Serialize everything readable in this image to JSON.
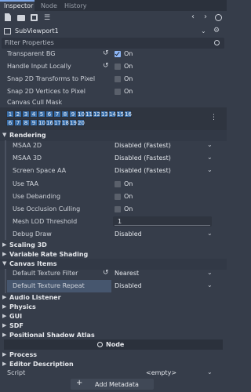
{
  "tabs": [
    "Inspector",
    "Node",
    "History"
  ],
  "node_name": "SubViewport1",
  "filter_placeholder": "Filter Properties",
  "props_top": [
    {
      "label": "Transparent BG",
      "value": "On",
      "checked": true,
      "revert": true
    },
    {
      "label": "Handle Input Locally",
      "value": "On",
      "checked": false,
      "revert": true
    },
    {
      "label": "Snap 2D Transforms to Pixel",
      "value": "On",
      "checked": false,
      "revert": false
    },
    {
      "label": "Snap 2D Vertices to Pixel",
      "value": "On",
      "checked": false,
      "revert": false
    }
  ],
  "cull_mask_label": "Canvas Cull Mask",
  "cull_mask_row1": [
    "1",
    "2",
    "3",
    "4",
    "5",
    "6",
    "7",
    "8",
    "9",
    "10",
    "11",
    "12",
    "13",
    "14",
    "15",
    "16"
  ],
  "cull_mask_row2": [
    "6",
    "7",
    "8",
    "9",
    "10",
    "16",
    "17",
    "18",
    "19",
    "20"
  ],
  "rendering": {
    "title": "Rendering",
    "msaa2d": {
      "label": "MSAA 2D",
      "value": "Disabled (Fastest)"
    },
    "msaa3d": {
      "label": "MSAA 3D",
      "value": "Disabled (Fastest)"
    },
    "ssaa": {
      "label": "Screen Space AA",
      "value": "Disabled (Fastest)"
    },
    "taa": {
      "label": "Use TAA",
      "value": "On"
    },
    "debanding": {
      "label": "Use Debanding",
      "value": "On"
    },
    "occlusion": {
      "label": "Use Occlusion Culling",
      "value": "On"
    },
    "lod": {
      "label": "Mesh LOD Threshold",
      "value": "1"
    },
    "debug": {
      "label": "Debug Draw",
      "value": "Disabled"
    }
  },
  "sections_mid": [
    "Scaling 3D",
    "Variable Rate Shading"
  ],
  "canvas_items": {
    "title": "Canvas Items",
    "filter": {
      "label": "Default Texture Filter",
      "value": "Nearest"
    },
    "repeat": {
      "label": "Default Texture Repeat",
      "value": "Disabled"
    }
  },
  "sections_low": [
    "Audio Listener",
    "Physics",
    "GUI",
    "SDF",
    "Positional Shadow Atlas"
  ],
  "node_header": "Node",
  "sections_node": [
    "Process",
    "Editor Description"
  ],
  "script": {
    "label": "Script",
    "value": "<empty>"
  },
  "add_metadata": "Add Metadata",
  "colors": {
    "bg": "#363d4a",
    "accent": "#8db6f7",
    "mask": "#3a6ea8"
  }
}
